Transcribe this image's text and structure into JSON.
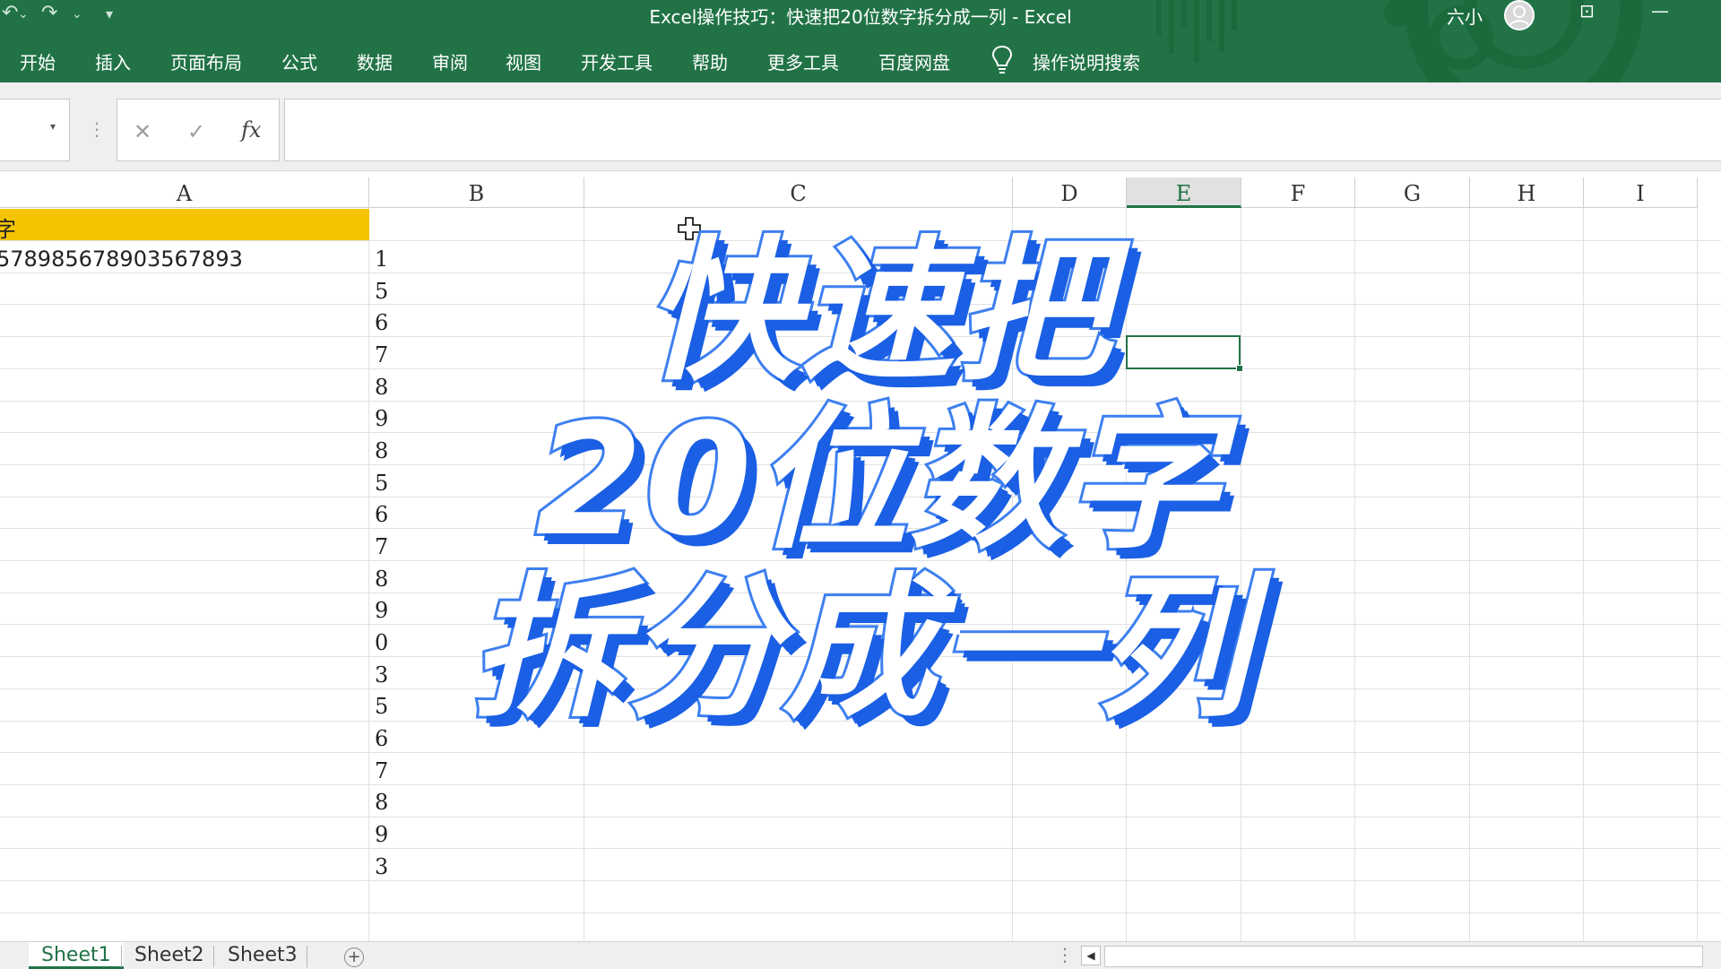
{
  "window": {
    "title": "Excel操作技巧：快速把20位数字拆分成一列 - Excel",
    "user_name": "六小",
    "accent_color": "#217346"
  },
  "quick_access": {
    "undo_icon": "undo-icon",
    "redo_icon": "redo-icon",
    "customize_icon": "customize-toolbar-icon"
  },
  "ribbon": {
    "tabs": [
      {
        "label": "开始"
      },
      {
        "label": "插入"
      },
      {
        "label": "页面布局"
      },
      {
        "label": "公式"
      },
      {
        "label": "数据"
      },
      {
        "label": "审阅"
      },
      {
        "label": "视图"
      },
      {
        "label": "开发工具"
      },
      {
        "label": "帮助"
      },
      {
        "label": "更多工具"
      },
      {
        "label": "百度网盘"
      }
    ],
    "tell_me": "操作说明搜索"
  },
  "formula_bar": {
    "cancel_glyph": "✕",
    "enter_glyph": "✓",
    "fx_label": "fx",
    "value": ""
  },
  "grid": {
    "columns": [
      {
        "label": "A"
      },
      {
        "label": "B"
      },
      {
        "label": "C"
      },
      {
        "label": "D"
      },
      {
        "label": "E"
      },
      {
        "label": "F"
      },
      {
        "label": "G"
      },
      {
        "label": "H"
      },
      {
        "label": "I"
      }
    ],
    "selected_column": "E",
    "header_fill_color": "#f5c400",
    "a1_text": "字",
    "a2_text": "578985678903567893",
    "b_values": [
      "1",
      "5",
      "6",
      "7",
      "8",
      "9",
      "8",
      "5",
      "6",
      "7",
      "8",
      "9",
      "0",
      "3",
      "5",
      "6",
      "7",
      "8",
      "9",
      "3"
    ]
  },
  "overlay": {
    "line1": "快速把",
    "line2": "20位数字",
    "line3": "拆分成一列",
    "fill_color": "#ffffff",
    "stroke_color": "#3d7ff0"
  },
  "sheets": {
    "tabs": [
      {
        "label": "Sheet1"
      },
      {
        "label": "Sheet2"
      },
      {
        "label": "Sheet3"
      }
    ],
    "active": "Sheet1",
    "add_glyph": "+"
  }
}
